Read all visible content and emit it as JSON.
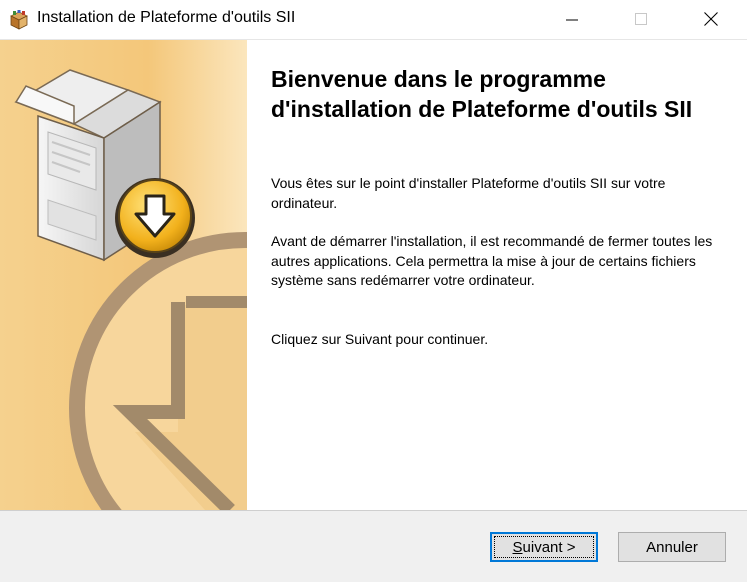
{
  "window": {
    "title": "Installation de Plateforme d'outils SII",
    "icon": "installer-package-icon",
    "controls": [
      "minimize-icon",
      "maximize-icon",
      "close-icon"
    ]
  },
  "side_panel": {
    "image": "installer-box-download-illustration",
    "colors": {
      "background": "#f4c77a",
      "arrow": "#a08a6a"
    }
  },
  "content": {
    "heading": "Bienvenue dans le programme d'installation de Plateforme d'outils SII",
    "paragraphs": [
      "Vous êtes sur le point d'installer Plateforme d'outils SII sur votre ordinateur.",
      "Avant de démarrer l'installation, il est recommandé de fermer toutes les autres applications. Cela permettra la mise à jour de certains fichiers système sans redémarrer votre ordinateur.",
      "Cliquez sur Suivant pour continuer."
    ]
  },
  "buttons": {
    "next": {
      "mnemonic": "S",
      "rest": "uivant >"
    },
    "cancel": "Annuler"
  },
  "colors": {
    "focus_accent": "#0078d7",
    "footer": "#f0f0f0"
  }
}
